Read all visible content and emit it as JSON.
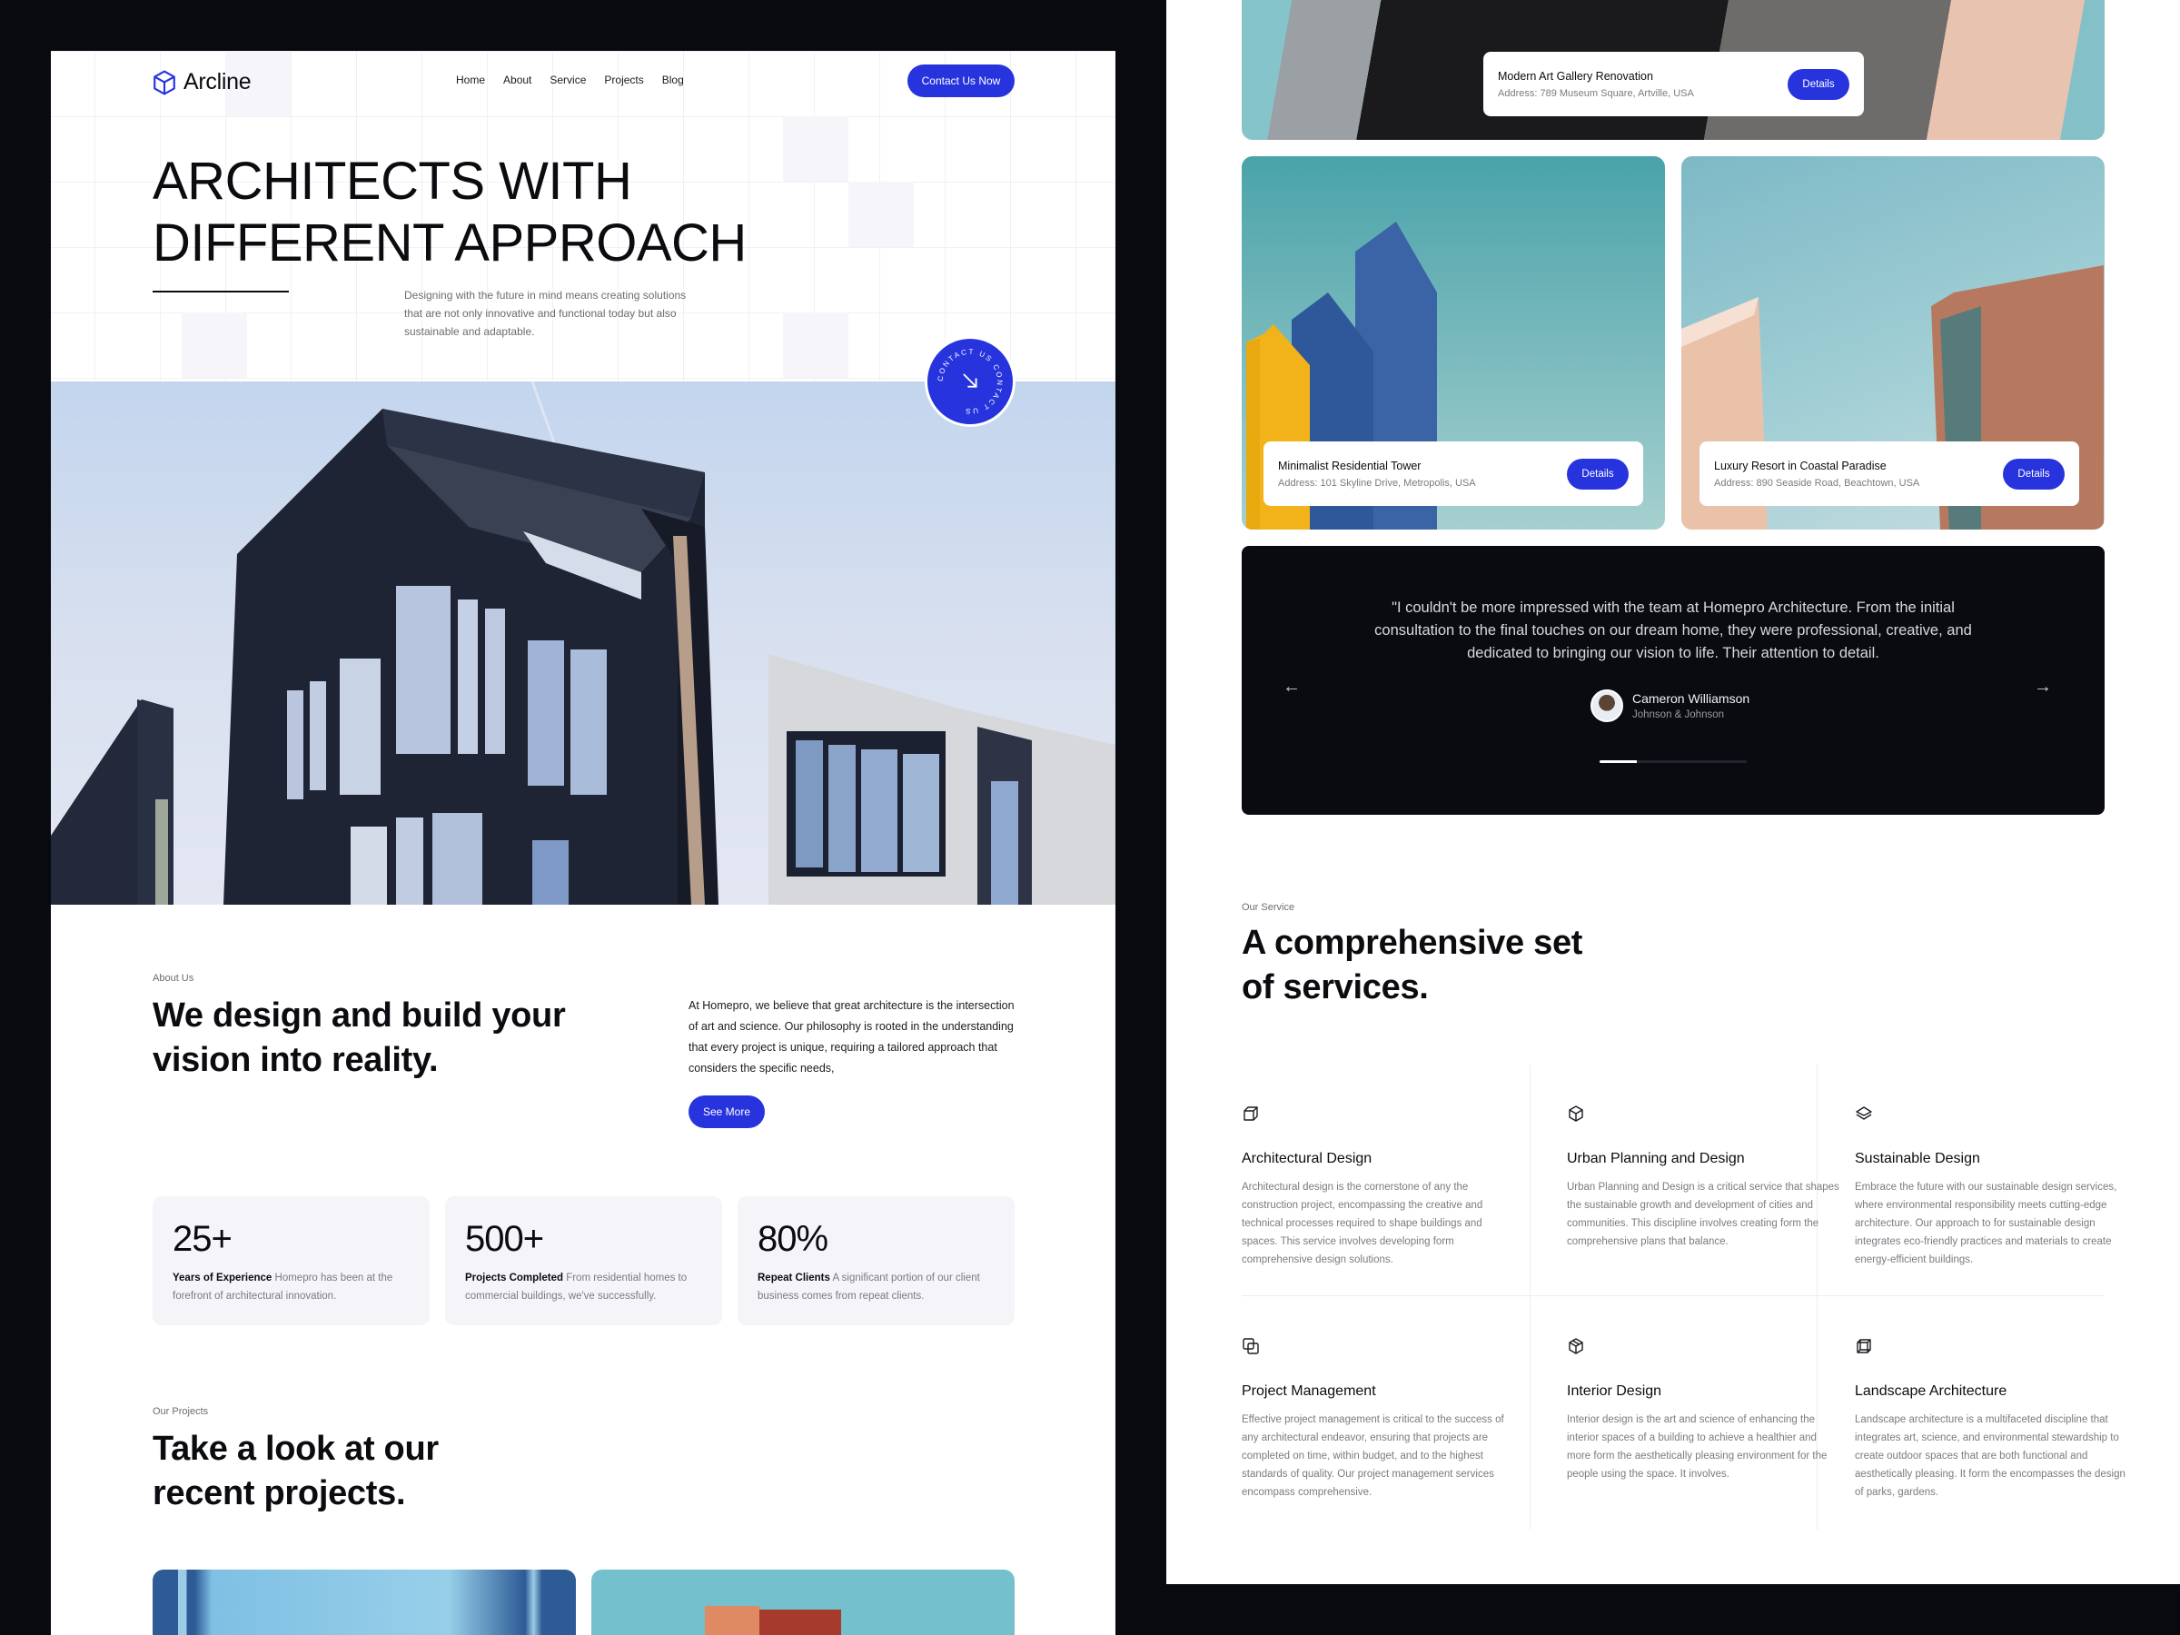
{
  "brand": {
    "name": "Arcline",
    "accent": "#2734de",
    "dark": "#0a0b10"
  },
  "nav": {
    "links": [
      "Home",
      "About",
      "Service",
      "Projects",
      "Blog"
    ],
    "cta": "Contact Us Now"
  },
  "hero": {
    "title_line1": "ARCHITECTS WITH",
    "title_line2": "DIFFERENT APPROACH",
    "description": "Designing with the future in mind means creating solutions that are not only innovative and functional today but also sustainable and adaptable.",
    "badge_text": "CONTACT US CONTACT US"
  },
  "about": {
    "label": "About Us",
    "title": "We design and build your vision into reality.",
    "text": "At Homepro, we believe that great architecture is the intersection of art and science. Our philosophy is rooted in the understanding that every project is unique, requiring a tailored approach that considers the specific needs,",
    "button": "See More"
  },
  "stats": [
    {
      "value": "25+",
      "label": "Years of Experience",
      "text": "Homepro has been at the forefront of architectural innovation."
    },
    {
      "value": "500+",
      "label": "Projects Completed",
      "text": "From residential homes to commercial buildings, we've successfully."
    },
    {
      "value": "80%",
      "label": "Repeat Clients",
      "text": "A significant portion of our client business comes from repeat clients."
    }
  ],
  "projects": {
    "label": "Our Projects",
    "title": "Take a look at our recent projects.",
    "items": [
      {
        "name": "Modern Art Gallery Renovation",
        "address": "Address: 789 Museum Square, Artville, USA",
        "button": "Details"
      },
      {
        "name": "Minimalist Residential Tower",
        "address": "Address: 101 Skyline Drive, Metropolis, USA",
        "button": "Details"
      },
      {
        "name": "Luxury Resort in Coastal Paradise",
        "address": "Address: 890 Seaside Road, Beachtown, USA",
        "button": "Details"
      }
    ]
  },
  "testimonial": {
    "quote": "\"I couldn't be more impressed with the team at Homepro Architecture. From the initial consultation to the final touches on our dream home, they were professional, creative, and dedicated to bringing our vision to life. Their attention to detail.",
    "author": "Cameron Williamson",
    "company": "Johnson & Johnson",
    "progress_fraction": 0.25
  },
  "services": {
    "label": "Our Service",
    "title": "A comprehensive set of services.",
    "items": [
      {
        "icon": "cube-outline-icon",
        "name": "Architectural Design",
        "desc": "Architectural design is the cornerstone of any the construction project, encompassing the creative and technical processes required to shape buildings and spaces. This service involves developing form comprehensive design solutions."
      },
      {
        "icon": "hexagon-cube-icon",
        "name": "Urban Planning and Design",
        "desc": "Urban Planning and Design is a critical service that shapes the sustainable growth and development of cities and communities. This discipline involves creating form the comprehensive plans that balance."
      },
      {
        "icon": "layers-icon",
        "name": "Sustainable Design",
        "desc": "Embrace the future with our sustainable design services, where environmental responsibility meets cutting-edge architecture. Our approach to for sustainable design integrates eco-friendly practices and materials to create energy-efficient buildings."
      },
      {
        "icon": "overlap-squares-icon",
        "name": "Project Management",
        "desc": "Effective project management is critical to the success of any architectural endeavor, ensuring that projects are completed on time, within budget, and to the highest standards of quality. Our project management services encompass comprehensive."
      },
      {
        "icon": "box-icon",
        "name": "Interior Design",
        "desc": "Interior design is the art and science of enhancing the interior spaces of a building to achieve a healthier and more form the aesthetically pleasing environment for the people using the space. It involves."
      },
      {
        "icon": "wireframe-cube-icon",
        "name": "Landscape Architecture",
        "desc": "Landscape architecture is a multifaceted discipline that integrates art, science, and environmental stewardship to create outdoor spaces that are both functional and aesthetically pleasing. It form the encompasses the design of parks, gardens."
      }
    ]
  }
}
